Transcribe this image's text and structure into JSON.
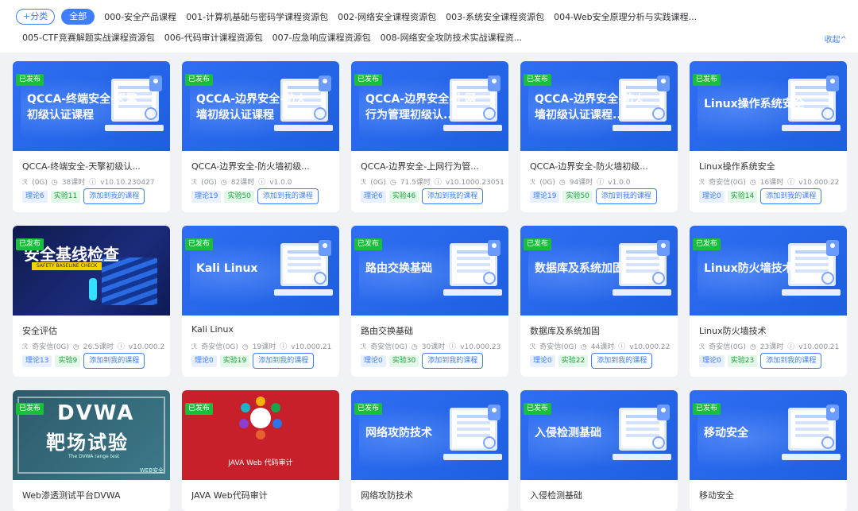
{
  "filter": {
    "add_category": "+分类",
    "all": "全部",
    "categories_row1": [
      "000-安全产品课程",
      "001-计算机基础与密码学课程资源包",
      "002-网络安全课程资源包",
      "003-系统安全课程资源包",
      "004-Web安全原理分析与实践课程..."
    ],
    "categories_row2": [
      "005-CTF竞赛解题实战课程资源包",
      "006-代码审计课程资源包",
      "007-应急响应课程资源包",
      "008-网络安全攻防技术实战课程资..."
    ],
    "collapse": "收起^"
  },
  "labels": {
    "published": "已发布",
    "add_course": "添加到我的课程"
  },
  "cards": [
    {
      "thumb": "QCCA-终端安全-天擎初级认证课程",
      "title": "QCCA-终端安全-天擎初级认...",
      "author": "(0G)",
      "hours": "38课时",
      "version": "v10.10.230427",
      "theory": "理论6",
      "lab": "实验11"
    },
    {
      "thumb": "QCCA-边界安全-防火墙初级认证课程",
      "title": "QCCA-边界安全-防火墙初级...",
      "author": "(0G)",
      "hours": "82课时",
      "version": "v1.0.0",
      "theory": "理论19",
      "lab": "实验50"
    },
    {
      "thumb": "QCCA-边界安全-上网行为管理初级认...",
      "title": "QCCA-边界安全-上网行为管...",
      "author": "(0G)",
      "hours": "71.5课时",
      "version": "v10.1000.23051",
      "theory": "理论6",
      "lab": "实验46"
    },
    {
      "thumb": "QCCA-边界安全-防火墙初级认证课程...",
      "title": "QCCA-边界安全-防火墙初级...",
      "author": "(0G)",
      "hours": "94课时",
      "version": "v1.0.0",
      "theory": "理论19",
      "lab": "实验50"
    },
    {
      "thumb": "Linux操作系统安全",
      "title": "Linux操作系统安全",
      "author": "奇安信(0G)",
      "hours": "16课时",
      "version": "v10.000.22",
      "theory": "理论0",
      "lab": "实验14"
    },
    {
      "thumb": "安全基线检查",
      "thumb_sub": "SAFETY BASELINE CHECK",
      "title": "安全评估",
      "author": "奇安信(0G)",
      "hours": "26.5课时",
      "version": "v10.000.2",
      "theory": "理论13",
      "lab": "实验9"
    },
    {
      "thumb": "Kali Linux",
      "title": "Kali Linux",
      "author": "奇安信(0G)",
      "hours": "19课时",
      "version": "v10.000.21",
      "theory": "理论0",
      "lab": "实验19"
    },
    {
      "thumb": "路由交换基础",
      "title": "路由交换基础",
      "author": "奇安信(0G)",
      "hours": "30课时",
      "version": "v10.000.23",
      "theory": "理论0",
      "lab": "实验30"
    },
    {
      "thumb": "数据库及系统加固",
      "title": "数据库及系统加固",
      "author": "奇安信(0G)",
      "hours": "44课时",
      "version": "v10.000.22",
      "theory": "理论0",
      "lab": "实验22"
    },
    {
      "thumb": "Linux防火墙技术",
      "title": "Linux防火墙技术",
      "author": "奇安信(0G)",
      "hours": "23课时",
      "version": "v10.000.21",
      "theory": "理论0",
      "lab": "实验23"
    },
    {
      "thumb_l1": "DVWA",
      "thumb_l2": "靶场试验",
      "thumb_l3": "The DVWA range test",
      "thumb_l4": "WEB安全",
      "title": "Web渗透测试平台DVWA"
    },
    {
      "thumb": "JAVA Web 代码审计",
      "title": "JAVA Web代码审计"
    },
    {
      "thumb": "网络攻防技术",
      "title": "网络攻防技术"
    },
    {
      "thumb": "入侵检测基础",
      "title": "入侵检测基础"
    },
    {
      "thumb": "移动安全",
      "title": "移动安全"
    }
  ]
}
